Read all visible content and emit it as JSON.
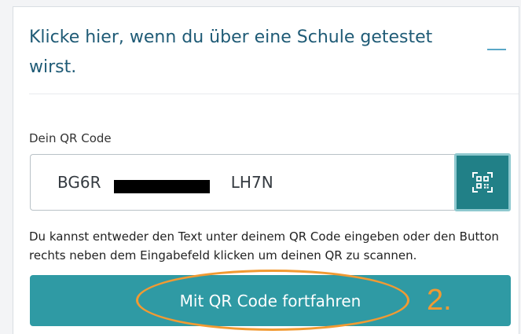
{
  "accordion": {
    "title": "Klicke hier, wenn du über eine Schule getestet wirst.",
    "icon": "minus-icon"
  },
  "qr_code": {
    "label": "Dein QR Code",
    "value_prefix": "BG6R",
    "value_suffix": "LH7N",
    "redacted": true,
    "scan_icon": "qr-scan-icon"
  },
  "help_text": "Du kannst entweder den Text unter deinem QR Code eingeben oder den Button rechts neben dem Eingabefeld klicken um deinen QR zu scannen.",
  "continue_button": {
    "label": "Mit QR Code fortfahren"
  },
  "annotation": {
    "step": "2.",
    "color": "#f29a32"
  },
  "colors": {
    "heading": "#1f5b76",
    "primary_button": "#2f9aa4",
    "scan_button": "#218087"
  }
}
